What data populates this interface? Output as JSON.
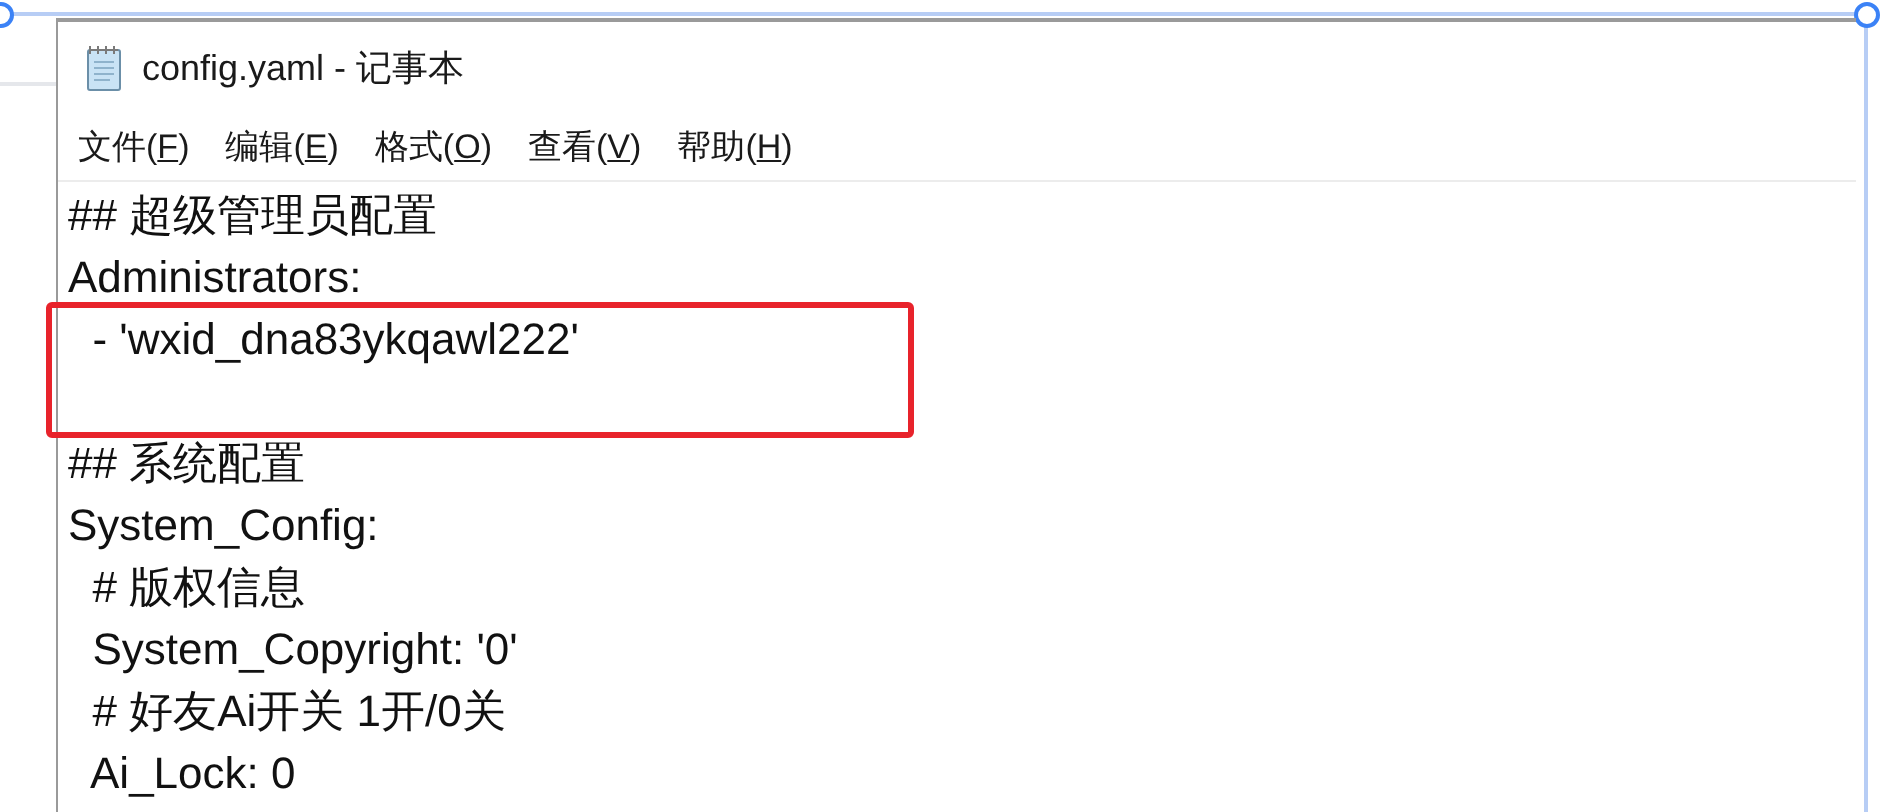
{
  "window": {
    "title": "config.yaml - 记事本"
  },
  "menu": [
    {
      "before": "文件(",
      "key": "F",
      "after": ")"
    },
    {
      "before": "编辑(",
      "key": "E",
      "after": ")"
    },
    {
      "before": "格式(",
      "key": "O",
      "after": ")"
    },
    {
      "before": "查看(",
      "key": "V",
      "after": ")"
    },
    {
      "before": "帮助(",
      "key": "H",
      "after": ")"
    }
  ],
  "lines": [
    {
      "text": "## 超级管理员配置",
      "highlighted": false
    },
    {
      "text": "Administrators:",
      "highlighted": false
    },
    {
      "text": "  - 'wxid_dna83ykqawl222'",
      "highlighted": true
    },
    {
      "highlighted": true
    },
    {
      "text": "## 系统配置",
      "highlighted": false
    },
    {
      "text": "System_Config:",
      "highlighted": false
    },
    {
      "text": "  # 版权信息",
      "highlighted": false
    },
    {
      "text": "  System_Copyright: '0'",
      "highlighted": false
    },
    {
      "text": "  # 好友Ai开关 1开/0关",
      "highlighted": false
    },
    {
      "text": "  Ai_Lock: 0",
      "highlighted": false
    }
  ]
}
